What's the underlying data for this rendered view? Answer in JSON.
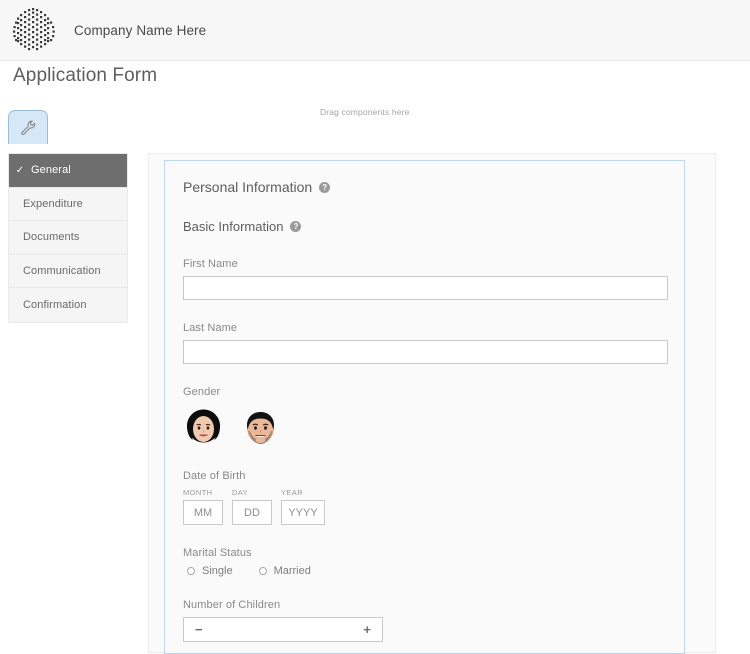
{
  "header": {
    "logo_icon": "halftone-dots-logo",
    "company_name": "Company Name Here"
  },
  "page": {
    "title": "Application Form",
    "drag_hint": "Drag components here"
  },
  "toolbar": {
    "tool_icon": "wrench-icon",
    "tool_tab_label": ""
  },
  "sidebar": {
    "items": [
      {
        "label": "General",
        "active": true,
        "check": "✓"
      },
      {
        "label": "Expenditure",
        "active": false
      },
      {
        "label": "Documents",
        "active": false
      },
      {
        "label": "Communication",
        "active": false
      },
      {
        "label": "Confirmation",
        "active": false
      }
    ]
  },
  "form": {
    "section_title": "Personal Information",
    "sub_title": "Basic Information",
    "help_glyph": "?",
    "first_name": {
      "label": "First Name",
      "value": "",
      "placeholder": ""
    },
    "last_name": {
      "label": "Last Name",
      "value": "",
      "placeholder": ""
    },
    "gender": {
      "label": "Gender",
      "options": [
        {
          "icon": "female-avatar-icon",
          "name": "female"
        },
        {
          "icon": "male-avatar-icon",
          "name": "male"
        }
      ]
    },
    "dob": {
      "label": "Date of Birth",
      "fields": [
        {
          "caption": "MONTH",
          "placeholder": "MM",
          "value": ""
        },
        {
          "caption": "DAY",
          "placeholder": "DD",
          "value": ""
        },
        {
          "caption": "YEAR",
          "placeholder": "YYYY",
          "value": ""
        }
      ]
    },
    "marital_status": {
      "label": "Marital Status",
      "options": [
        {
          "label": "Single",
          "selected": false
        },
        {
          "label": "Married",
          "selected": false
        }
      ]
    },
    "children": {
      "label": "Number of Children",
      "minus": "−",
      "plus": "+",
      "value": ""
    }
  },
  "colors": {
    "header_bg": "#f7f7f7",
    "sidebar_active_bg": "#6e6e6e",
    "panel_border_blue": "#bcd7ef",
    "tool_tab_bg": "#d6e8f7",
    "label_gray": "#8a8a8a"
  }
}
